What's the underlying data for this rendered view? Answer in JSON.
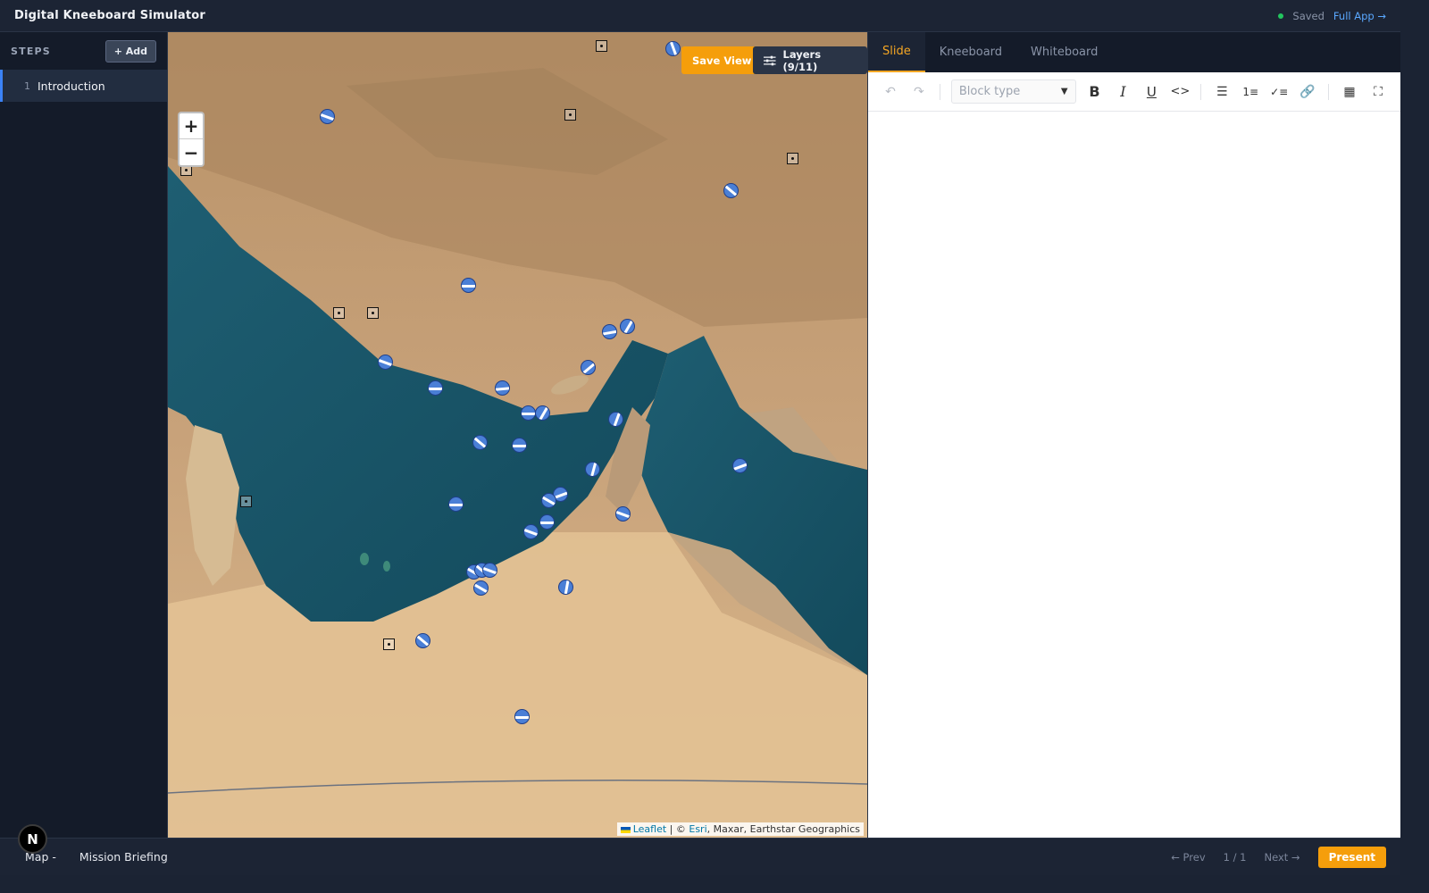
{
  "app": {
    "title": "Digital Kneeboard Simulator"
  },
  "topbar": {
    "status": "Saved",
    "full_app_link": "Full App →"
  },
  "sidebar": {
    "header": "STEPS",
    "add_button": "+ Add",
    "steps": [
      {
        "num": "1",
        "label": "Introduction"
      }
    ]
  },
  "map": {
    "save_view": "Save View",
    "layers_button": "Layers (9/11)",
    "zoom_in": "+",
    "zoom_out": "−",
    "attribution": {
      "leaflet": "Leaflet",
      "sep": " | © ",
      "esri": "Esri",
      "rest": ", Maxar, Earthstar Geographics"
    }
  },
  "right_panel": {
    "tabs": [
      "Slide",
      "Kneeboard",
      "Whiteboard"
    ],
    "active_tab": "Slide",
    "block_type_placeholder": "Block type"
  },
  "footer": {
    "map_label": "Map -",
    "briefing": "Mission Briefing",
    "prev": "← Prev",
    "page": "1 / 1",
    "next": "Next →",
    "present": "Present"
  },
  "colors": {
    "accent": "#f59e0b",
    "active_tab": "#f5a623",
    "link": "#5aa8ff",
    "saved": "#22c55e"
  }
}
